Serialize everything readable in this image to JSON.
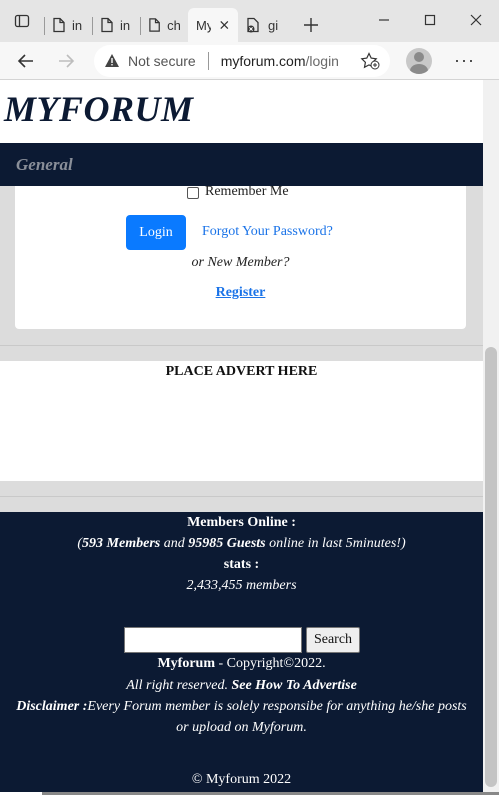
{
  "browser": {
    "tabs": [
      {
        "label": "in",
        "active": false
      },
      {
        "label": "in",
        "active": false
      },
      {
        "label": "ch",
        "active": false
      },
      {
        "label": "My",
        "active": true
      },
      {
        "label": "gi",
        "active": false
      }
    ],
    "address": {
      "security_label": "Not secure",
      "host": "myforum.com",
      "path": "/login"
    }
  },
  "site": {
    "title": "MYFORUM",
    "nav_item": "General"
  },
  "login": {
    "remember_label": "Remember Me",
    "login_button": "Login",
    "forgot_link": "Forgot Your Password?",
    "new_member_text": "or New Member?",
    "register_link": "Register"
  },
  "advert": {
    "text": "PLACE ADVERT HERE"
  },
  "footer": {
    "members_online_heading": "Members Online :",
    "online_members": "593 Members",
    "online_and": " and ",
    "online_guests": "95985 Guests",
    "online_suffix": " online in last 5minutes!)",
    "online_prefix": "(",
    "stats_heading": "stats :",
    "stats_value": "2,433,455 members",
    "search_input_value": "",
    "search_button": "Search",
    "brand": "Myforum",
    "copyright": " - Copyright©2022.",
    "rights": "All right reserved. ",
    "advertise_link": "See How To Advertise",
    "disclaimer_label": "Disclaimer :",
    "disclaimer_text": "Every Forum member is solely responsibe for anything he/she posts",
    "disclaimer_text2": "or upload on Myforum.",
    "bottom_copyright": "© Myforum 2022"
  }
}
